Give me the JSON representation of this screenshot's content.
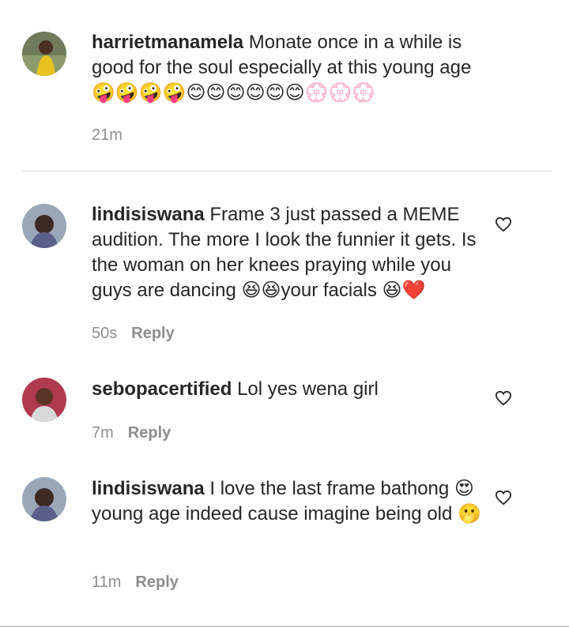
{
  "comments": [
    {
      "username": "harrietmanamela",
      "text": "Monate once in a while is good for the soul especially at this young age🤪🤪🤪🤪😊😊😊😊😊😊💮💮💮",
      "time": "21m",
      "reply": ""
    },
    {
      "username": "lindisiswana",
      "text": "Frame 3 just passed a MEME audition. The more I look the funnier it gets. Is the woman on her knees praying while you guys are dancing 😆😆your facials 😆❤️",
      "time": "50s",
      "reply": "Reply"
    },
    {
      "username": "sebopacertified",
      "text": "Lol yes wena girl",
      "time": "7m",
      "reply": "Reply"
    },
    {
      "username": "lindisiswana",
      "text": "I love the last frame bathong 😍 young age indeed cause imagine being old 🫢",
      "time": "11m",
      "reply": "Reply"
    }
  ],
  "icons": {
    "like": "heart-outline-icon"
  },
  "colors": {
    "text": "#262626",
    "muted": "#8e8e8e",
    "divider": "#dbdbdb"
  }
}
